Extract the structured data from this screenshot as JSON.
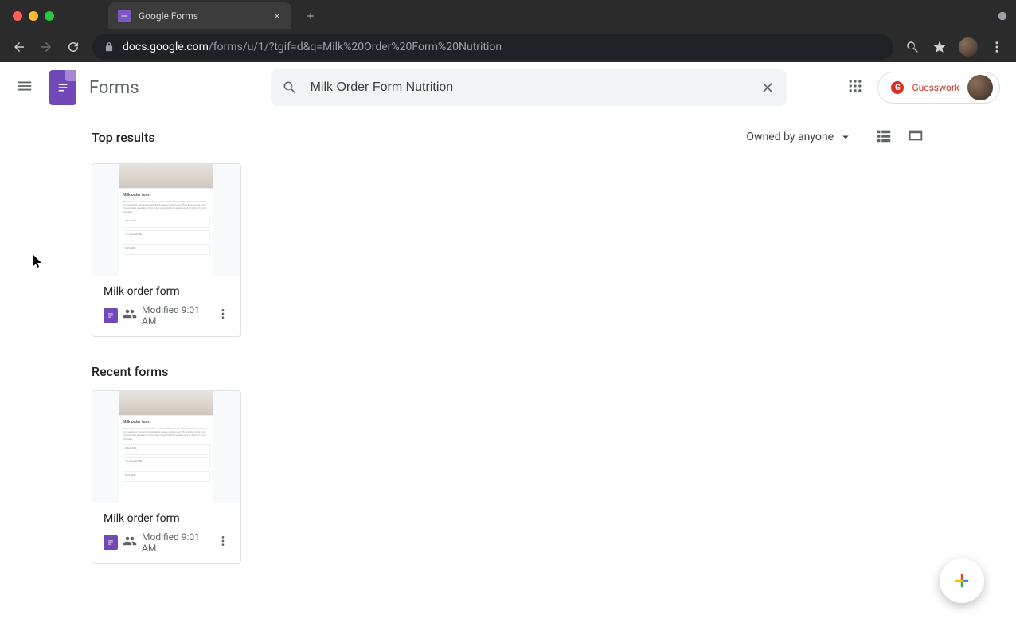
{
  "browser": {
    "tab_title": "Google Forms",
    "url_domain": "docs.google.com",
    "url_path": "/forms/u/1/?tgif=d&q=Milk%20Order%20Form%20Nutrition"
  },
  "app": {
    "title": "Forms",
    "search_value": "Milk Order Form Nutrition",
    "badge_label": "Guesswork"
  },
  "filter": {
    "section_title": "Top results",
    "owner_label": "Owned by anyone"
  },
  "sections": {
    "recent_title": "Recent forms"
  },
  "preview": {
    "title": "Milk order form",
    "desc": "Welcome to our order form for our online milk delivery with real-time experience. For questions concerning deliveries please contact our office and not this form. You can also place an online order using this form enabling us to deliver to your doorstep."
  },
  "cards": {
    "top": {
      "title": "Milk order form",
      "meta": "Modified 9:01 AM"
    },
    "recent": {
      "title": "Milk order form",
      "meta": "Modified 9:01 AM"
    }
  }
}
